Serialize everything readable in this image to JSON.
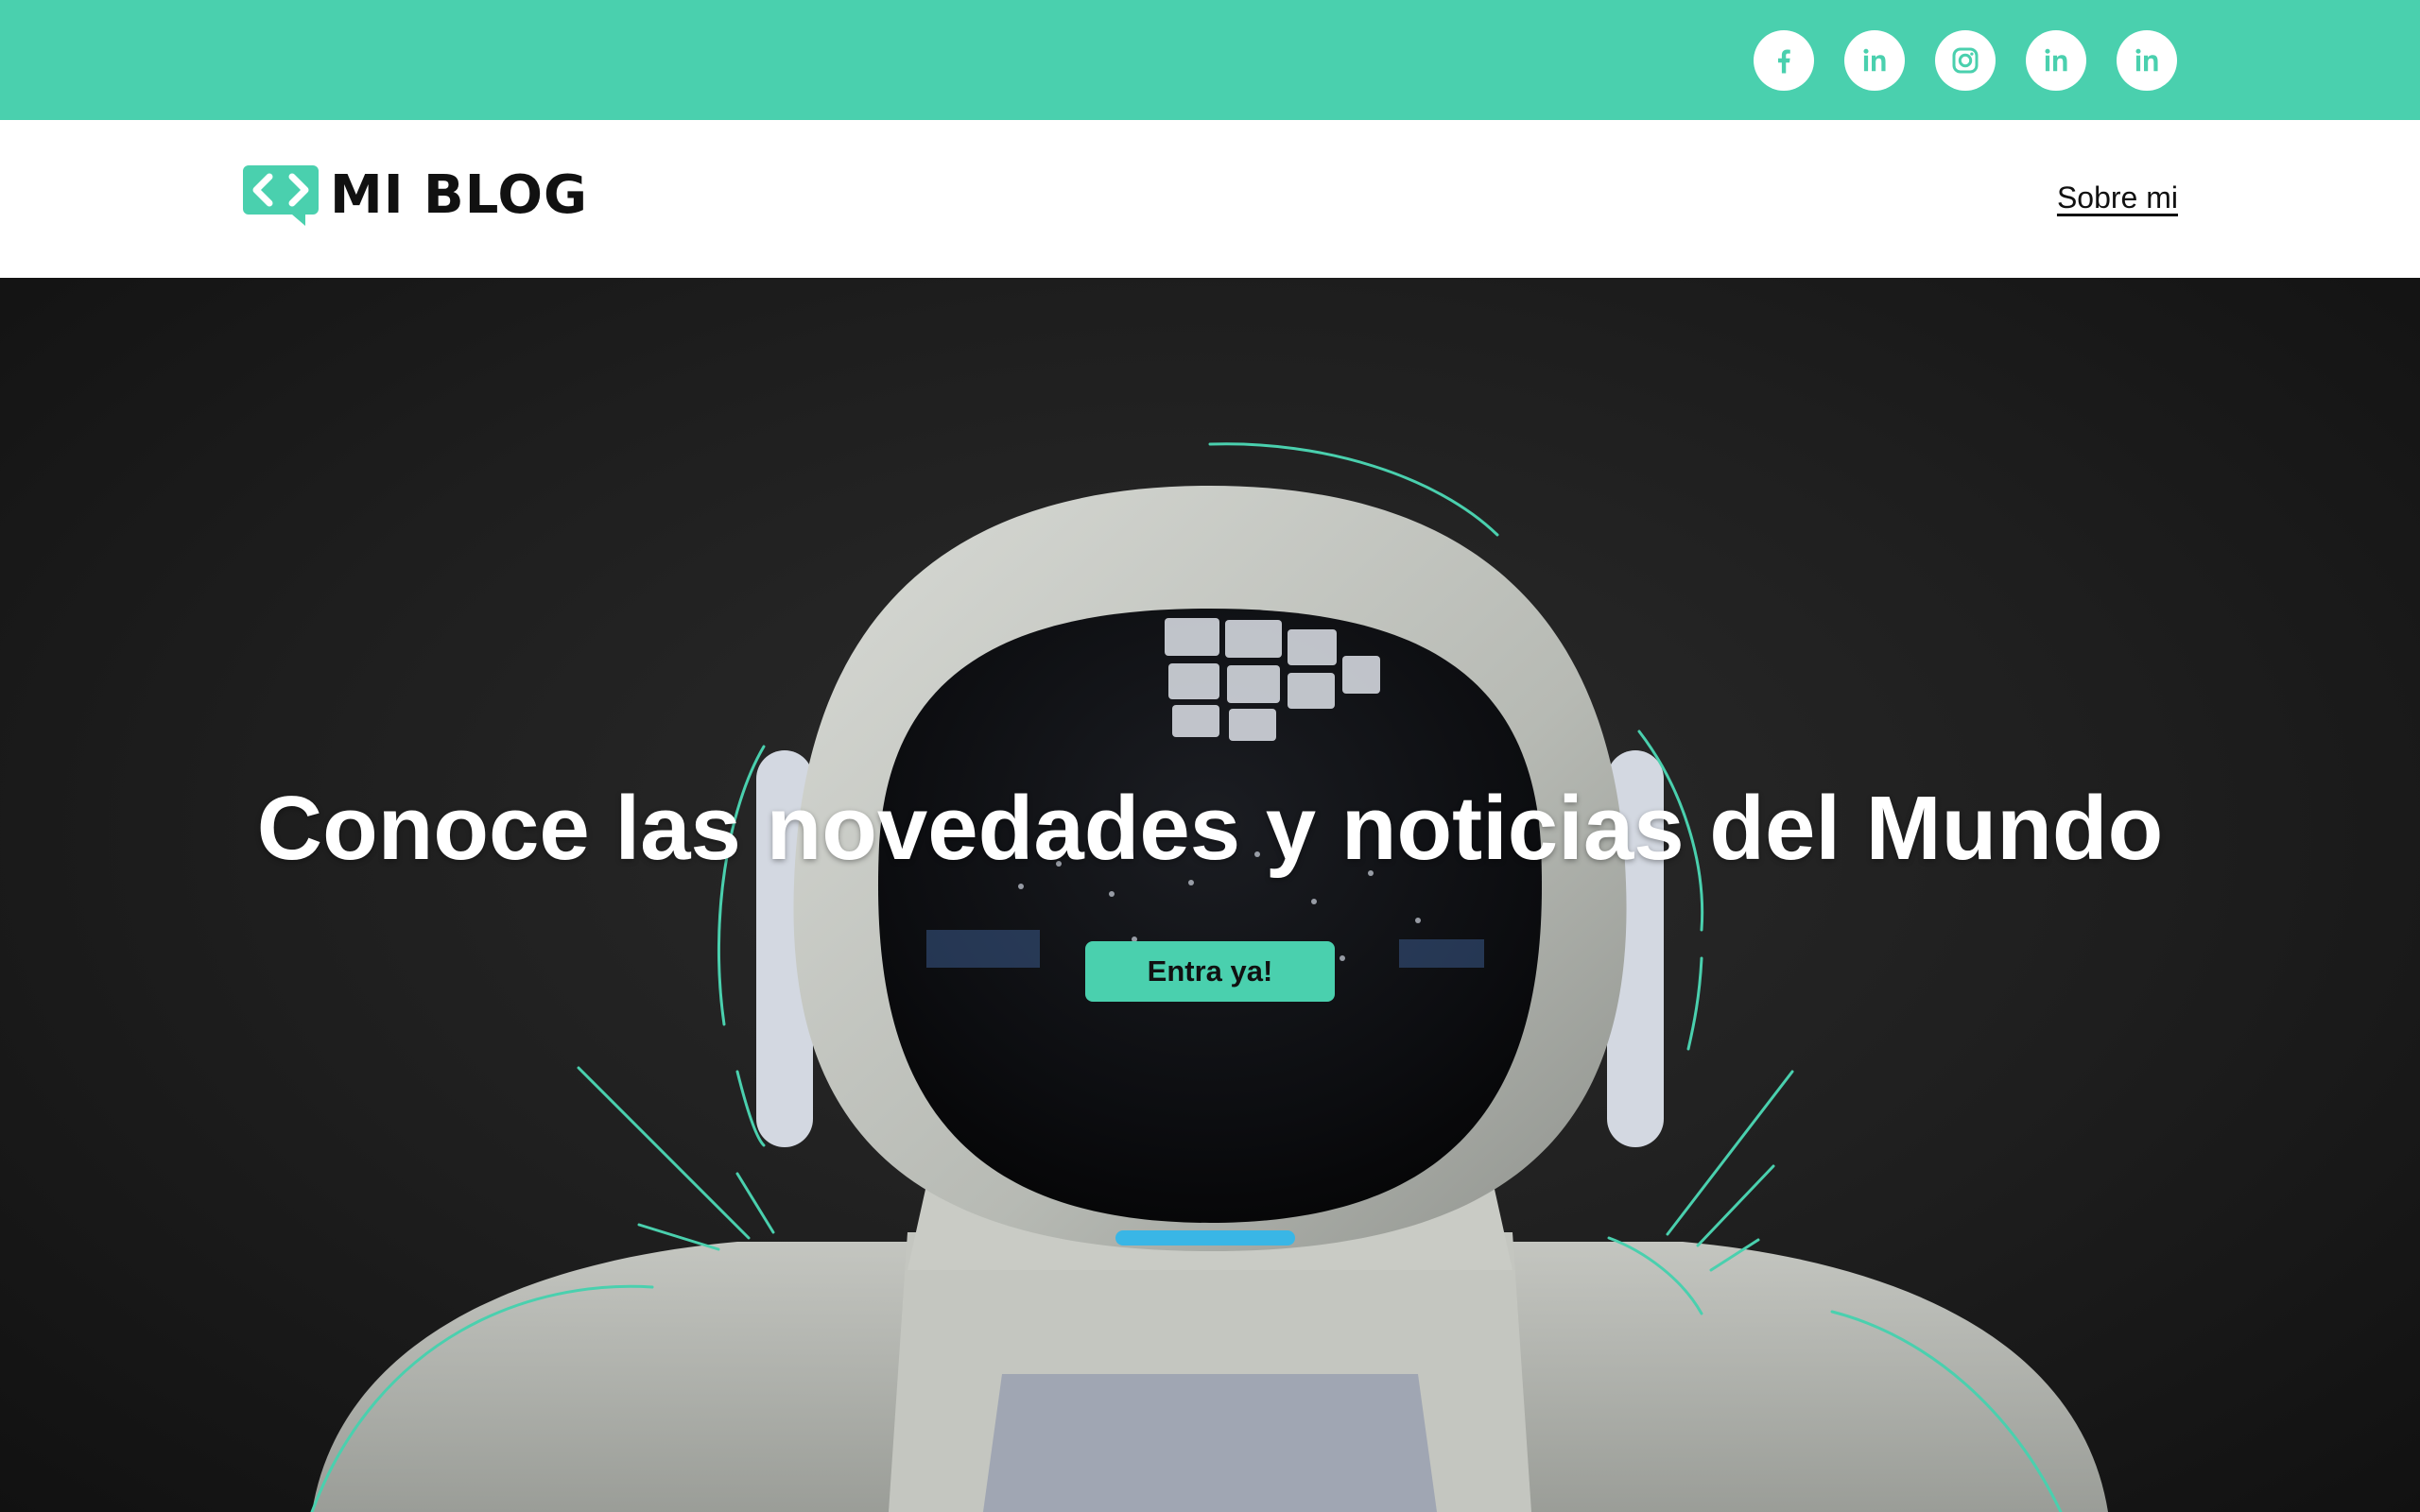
{
  "colors": {
    "accent": "#4ad0ae",
    "hero_background": "#1e1e1e",
    "text_dark": "#111111",
    "text_light": "#ffffff"
  },
  "social": [
    {
      "name": "facebook",
      "icon": "facebook-icon"
    },
    {
      "name": "linkedin",
      "icon": "linkedin-icon"
    },
    {
      "name": "instagram",
      "icon": "instagram-icon"
    },
    {
      "name": "linkedin",
      "icon": "linkedin-icon"
    },
    {
      "name": "linkedin",
      "icon": "linkedin-icon"
    }
  ],
  "header": {
    "logo_text": "MI BLOG",
    "logo_icon": "code-speech-bubble-icon",
    "nav_link": "Sobre mi"
  },
  "hero": {
    "title": "Conoce las novedades y noticias del Mundo",
    "button_label": "Entra ya!",
    "image": "robot-helmet-illustration"
  }
}
